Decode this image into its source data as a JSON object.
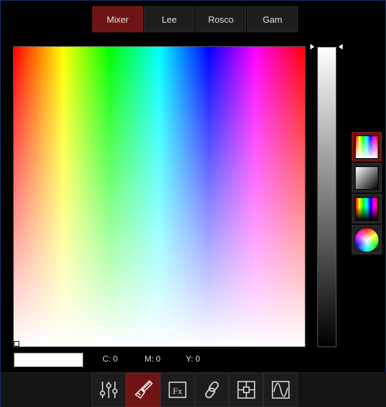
{
  "tabs": [
    {
      "label": "Mixer",
      "active": true
    },
    {
      "label": "Lee",
      "active": false
    },
    {
      "label": "Rosco",
      "active": false
    },
    {
      "label": "Gam",
      "active": false
    }
  ],
  "color": {
    "preview_hex": "#FFFFFF",
    "c_text": "C: 0",
    "m_text": "M: 0",
    "y_text": "Y: 0"
  },
  "modes": [
    {
      "name": "spectrum",
      "active": true
    },
    {
      "name": "grayscale",
      "active": false
    },
    {
      "name": "hue-shade",
      "active": false
    },
    {
      "name": "color-wheel",
      "active": false
    }
  ],
  "toolbar": {
    "tools": [
      {
        "icon": "sliders-icon",
        "active": false
      },
      {
        "icon": "brush-icon",
        "active": true
      },
      {
        "icon": "fx-icon",
        "active": false
      },
      {
        "icon": "link-icon",
        "active": false
      },
      {
        "icon": "position-icon",
        "active": false
      },
      {
        "icon": "waveform-icon",
        "active": false
      }
    ],
    "fx_label": "Fx"
  },
  "colors": {
    "accent": "#6E1414",
    "background": "#000000",
    "border": "#1C2F6E"
  }
}
